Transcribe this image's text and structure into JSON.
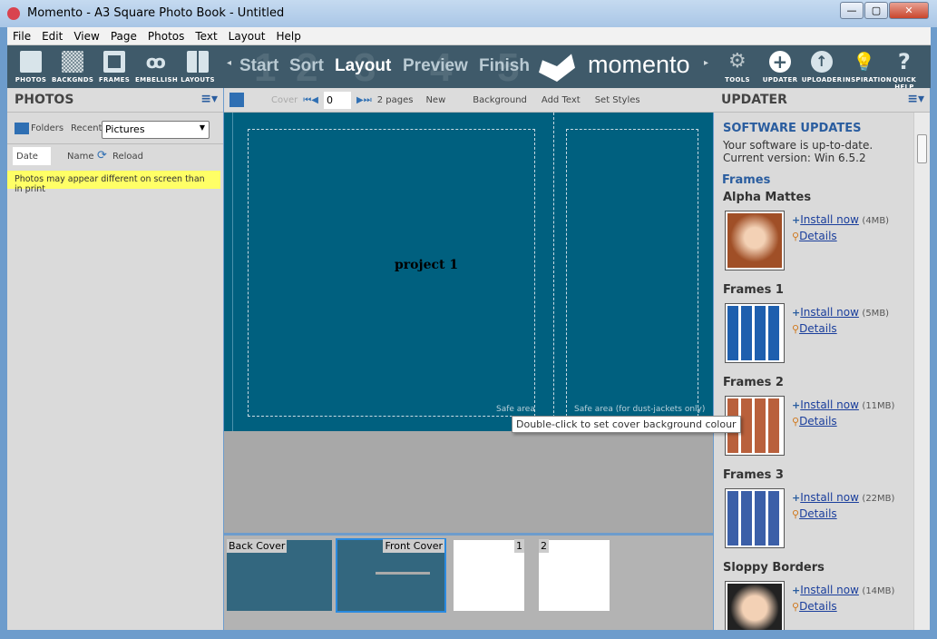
{
  "window": {
    "title": "Momento - A3 Square Photo Book - Untitled",
    "min": "—",
    "max": "▢",
    "close": "✕"
  },
  "menu": [
    "File",
    "Edit",
    "View",
    "Page",
    "Photos",
    "Text",
    "Layout",
    "Help"
  ],
  "tools_left": [
    {
      "label": "PHOTOS",
      "icon": "photo-icon"
    },
    {
      "label": "BACKGNDS",
      "icon": "backgrounds-icon"
    },
    {
      "label": "FRAMES",
      "icon": "frame-icon"
    },
    {
      "label": "EMBELLISH",
      "icon": "bow-icon"
    },
    {
      "label": "LAYOUTS",
      "icon": "layouts-icon"
    }
  ],
  "steps": [
    {
      "num": "1",
      "label": "Start"
    },
    {
      "num": "2",
      "label": "Sort"
    },
    {
      "num": "3",
      "label": "Layout",
      "active": true
    },
    {
      "num": "4",
      "label": "Preview"
    },
    {
      "num": "5",
      "label": "Finish"
    }
  ],
  "brand": "momento",
  "tools_right": [
    {
      "label": "TOOLS",
      "icon": "gears-icon"
    },
    {
      "label": "UPDATER",
      "icon": "plus-circle-icon"
    },
    {
      "label": "UPLOADER",
      "icon": "upload-icon"
    },
    {
      "label": "INSPIRATION",
      "icon": "lightbulb-icon"
    },
    {
      "label": "QUICK HELP",
      "icon": "question-icon"
    }
  ],
  "photos": {
    "title": "PHOTOS",
    "folders": "Folders",
    "recent": "Recent",
    "folder_select": "Pictures",
    "sort_date": "Date",
    "sort_name": "Name",
    "reload": "Reload",
    "warning": "Photos may appear different on screen than in print"
  },
  "editor": {
    "cover": "Cover",
    "page_input": "0",
    "pages": "2 pages",
    "new": "New",
    "background": "Background",
    "add_text": "Add Text",
    "set_styles": "Set Styles",
    "project_title": "project 1",
    "safe_area": "Safe area",
    "safe_area_dj": "Safe area (for dust-jackets only)",
    "tooltip": "Double-click to set cover background colour"
  },
  "thumbnails": [
    {
      "label": "Back Cover"
    },
    {
      "label": "Front Cover",
      "selected": true
    },
    {
      "label": "1"
    },
    {
      "label": "2"
    }
  ],
  "updater": {
    "title": "UPDATER",
    "heading": "SOFTWARE UPDATES",
    "status": "Your software is up-to-date.",
    "version": "Current version:  Win 6.5.2",
    "section": "Frames",
    "install": "Install now",
    "details": "Details",
    "items": [
      {
        "name": "Alpha Mattes",
        "size": "(4MB)"
      },
      {
        "name": "Frames 1",
        "size": "(5MB)"
      },
      {
        "name": "Frames 2",
        "size": "(11MB)"
      },
      {
        "name": "Frames 3",
        "size": "(22MB)"
      },
      {
        "name": "Sloppy Borders",
        "size": "(14MB)"
      }
    ]
  },
  "colors": {
    "toolbar": "#3f5a6a",
    "canvas": "#00607f",
    "warning": "#ffff66",
    "link": "#1a3e9c",
    "heading": "#2a5d9f"
  }
}
